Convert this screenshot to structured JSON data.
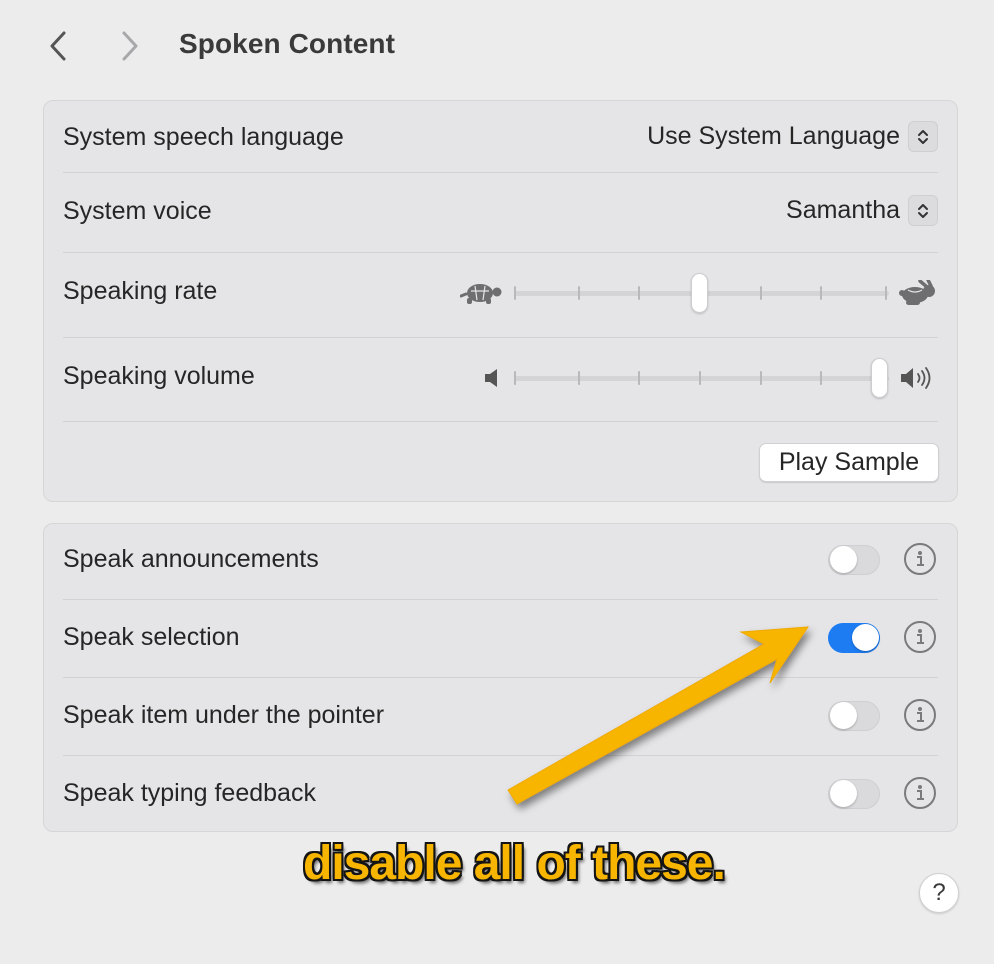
{
  "header": {
    "back_icon": "chevron-left-icon",
    "forward_icon": "chevron-right-icon",
    "title": "Spoken Content"
  },
  "speech_group": {
    "language": {
      "label": "System speech language",
      "value": "Use System Language"
    },
    "voice": {
      "label": "System voice",
      "value": "Samantha"
    },
    "rate": {
      "label": "Speaking rate",
      "min_icon": "turtle-icon",
      "max_icon": "rabbit-icon",
      "level": 0.5,
      "ticks": 7
    },
    "volume": {
      "label": "Speaking volume",
      "min_icon": "speaker-low-icon",
      "max_icon": "speaker-high-icon",
      "level": 1.0,
      "ticks": 7
    },
    "play_sample_label": "Play Sample"
  },
  "speak_group": {
    "items": [
      {
        "label": "Speak announcements",
        "enabled": false
      },
      {
        "label": "Speak selection",
        "enabled": true
      },
      {
        "label": "Speak item under the pointer",
        "enabled": false
      },
      {
        "label": "Speak typing feedback",
        "enabled": false
      }
    ]
  },
  "annotation": {
    "text": "disable all of these.",
    "color": "#f7b500"
  },
  "help_label": "?",
  "colors": {
    "toggle_on": "#1d7cf2",
    "background": "#ececed"
  }
}
